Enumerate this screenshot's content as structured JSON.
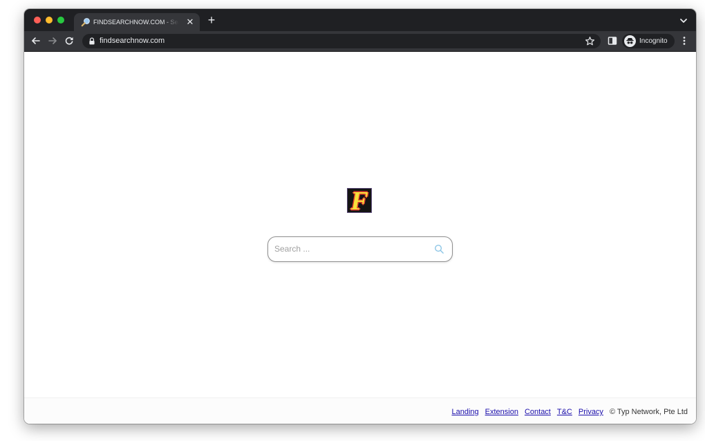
{
  "browser": {
    "tab": {
      "title": "FINDSEARCHNOW.COM - Search",
      "close_icon": "close-icon",
      "favicon": "magnifier-icon"
    },
    "new_tab_icon": "plus-icon",
    "tab_search_icon": "chevron-down-icon",
    "toolbar": {
      "back_icon": "arrow-left-icon",
      "forward_icon": "arrow-right-icon",
      "reload_icon": "reload-icon",
      "url": "findsearchnow.com",
      "lock_icon": "lock-icon",
      "bookmark_icon": "star-icon",
      "side_panel_icon": "side-panel-icon",
      "profile_label": "Incognito",
      "menu_icon": "kebab-menu-icon"
    },
    "colors": {
      "frame": "#1f2023",
      "toolbar": "#35363a",
      "omnibox": "#202124"
    }
  },
  "page": {
    "logo_letter": "F",
    "search": {
      "placeholder": "Search ...",
      "value": ""
    },
    "footer": {
      "links": [
        "Landing",
        "Extension",
        "Contact",
        "T&C",
        "Privacy"
      ],
      "copyright": "© Typ Network, Pte Ltd"
    },
    "colors": {
      "link": "#1a0dab",
      "search_icon": "#8ec6e6",
      "logo_fill": "#f5e03a",
      "logo_outline": "#e23b2e"
    }
  }
}
